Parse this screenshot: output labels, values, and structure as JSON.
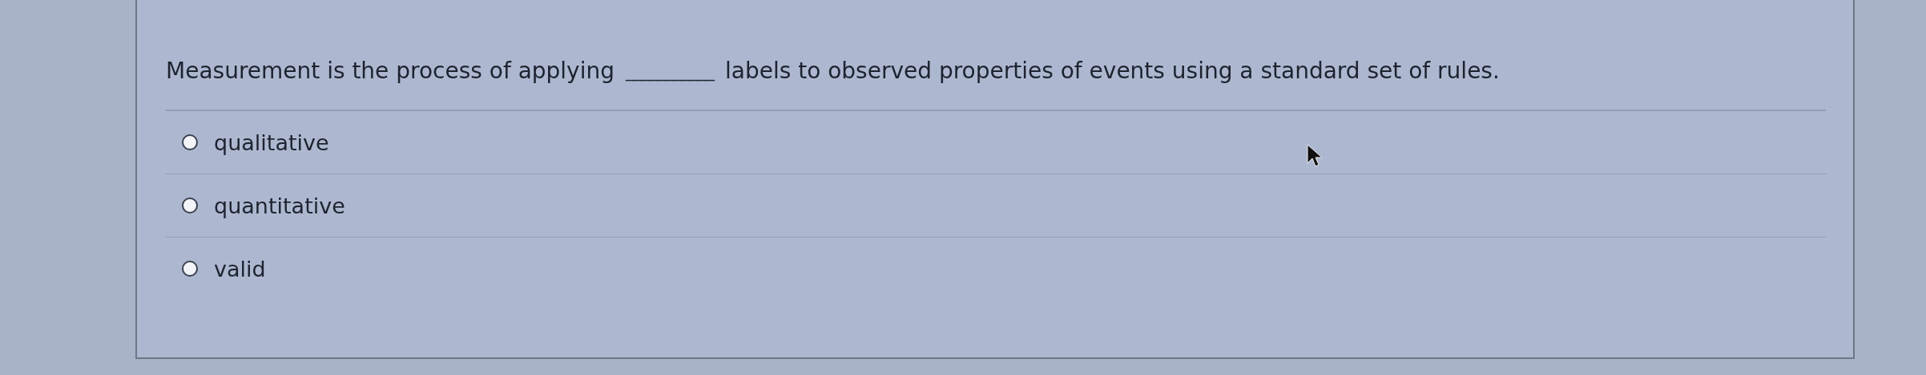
{
  "question": {
    "text_before": "Measurement is the process of applying",
    "blank": "___________",
    "text_after": "labels to observed properties of events using a standard set of rules."
  },
  "options": [
    {
      "label": "qualitative",
      "selected": false
    },
    {
      "label": "quantitative",
      "selected": false
    },
    {
      "label": "valid",
      "selected": false
    }
  ]
}
